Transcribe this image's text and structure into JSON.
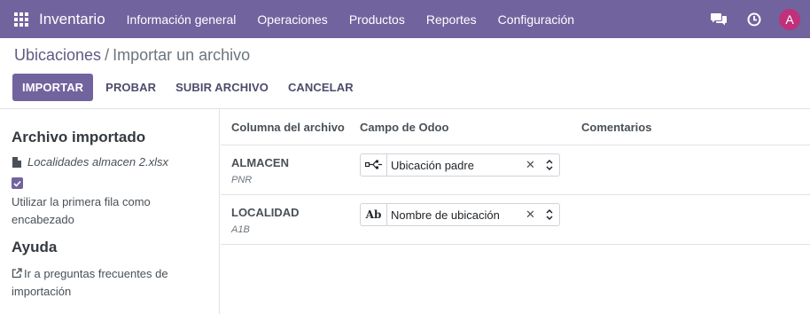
{
  "navbar": {
    "app_name": "Inventario",
    "menu": [
      "Información general",
      "Operaciones",
      "Productos",
      "Reportes",
      "Configuración"
    ],
    "avatar_initial": "A",
    "avatar_color": "#c0317c",
    "brand_color": "#71639e"
  },
  "breadcrumb": {
    "parent": "Ubicaciones",
    "separator": "/",
    "current": "Importar un archivo"
  },
  "toolbar": {
    "import_label": "IMPORTAR",
    "test_label": "PROBAR",
    "upload_label": "SUBIR ARCHIVO",
    "cancel_label": "CANCELAR"
  },
  "sidebar": {
    "imported_title": "Archivo importado",
    "file_name": "Localidades almacen 2.xlsx",
    "header_checkbox_checked": true,
    "header_checkbox_label": "Utilizar la primera fila como encabezado",
    "help_title": "Ayuda",
    "help_link": "Ir a preguntas frecuentes de importación"
  },
  "table": {
    "headers": [
      "Columna del archivo",
      "Campo de Odoo",
      "Comentarios"
    ],
    "rows": [
      {
        "column": "ALMACEN",
        "sample": "PNR",
        "field_type_icon": "many2one-icon",
        "field": "Ubicación padre",
        "comment": ""
      },
      {
        "column": "LOCALIDAD",
        "sample": "A1B",
        "field_type_icon": "char-field-icon",
        "field_type_text": "Ab",
        "field": "Nombre de ubicación",
        "comment": ""
      }
    ]
  }
}
